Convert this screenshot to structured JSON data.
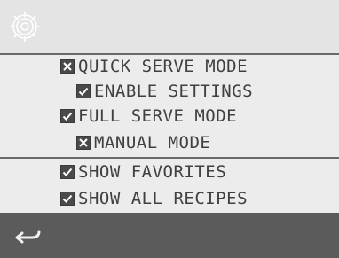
{
  "header": {
    "icon": "gear-icon"
  },
  "options": [
    {
      "key": "quick_serve",
      "label": "QUICK SERVE MODE",
      "state": "x"
    },
    {
      "key": "enable_settings",
      "label": "ENABLE SETTINGS",
      "state": "check"
    },
    {
      "key": "full_serve",
      "label": "FULL SERVE MODE",
      "state": "check"
    },
    {
      "key": "manual_mode",
      "label": "MANUAL MODE",
      "state": "x"
    },
    {
      "key": "show_favorites",
      "label": "SHOW FAVORITES",
      "state": "check"
    },
    {
      "key": "show_all_recipes",
      "label": "SHOW ALL RECIPES",
      "state": "check"
    }
  ],
  "footer": {
    "back_icon": "back-arrow-icon"
  },
  "colors": {
    "background": "#ececec",
    "footer": "#5b5b5b",
    "checkbox": "#4a4a4a",
    "text": "#404040"
  }
}
